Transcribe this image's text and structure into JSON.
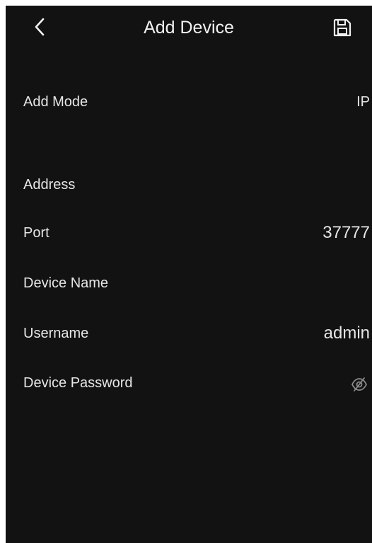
{
  "header": {
    "title": "Add Device",
    "back_icon": "chevron-left-icon",
    "save_icon": "floppy-disk-icon"
  },
  "form": {
    "add_mode": {
      "label": "Add Mode",
      "value": "IP"
    },
    "address": {
      "label": "Address",
      "value": ""
    },
    "port": {
      "label": "Port",
      "value": "37777"
    },
    "device_name": {
      "label": "Device Name",
      "value": ""
    },
    "username": {
      "label": "Username",
      "value": "admin"
    },
    "device_password": {
      "label": "Device Password",
      "value": "",
      "visibility_icon": "eye-off-icon"
    }
  },
  "colors": {
    "background": "#121212",
    "text": "#e6e6e6",
    "muted_icon": "#8a8a8a"
  }
}
